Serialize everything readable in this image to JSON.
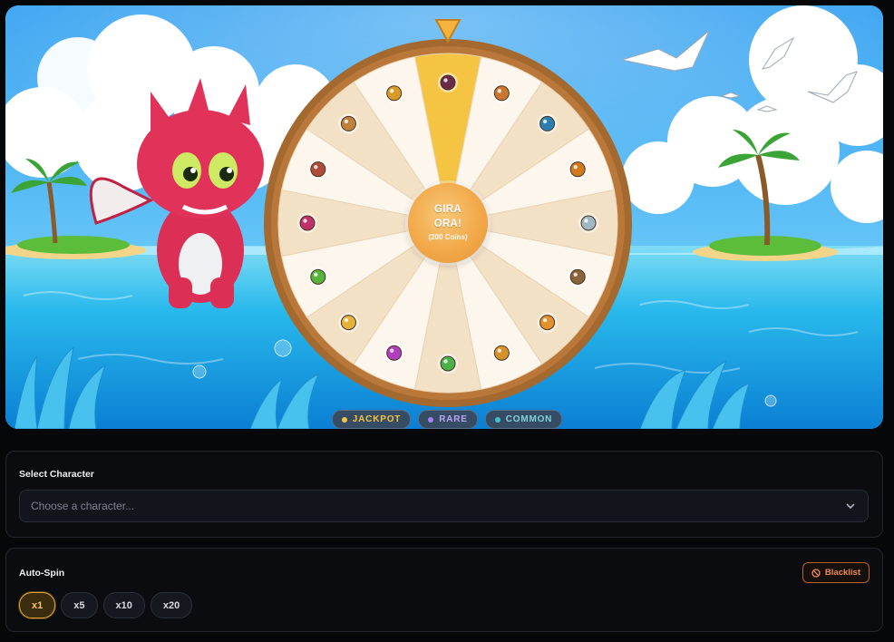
{
  "wheel": {
    "hub_line1": "GIRA",
    "hub_line2": "ORA!",
    "hub_line3": "(200 Coins)",
    "segments": [
      {
        "icon": "potion-bottle-icon",
        "rarity": "jackpot"
      },
      {
        "icon": "backpack-icon",
        "rarity": "common"
      },
      {
        "icon": "blue-crystal-icon",
        "rarity": "common"
      },
      {
        "icon": "gear-ring-icon",
        "rarity": "common"
      },
      {
        "icon": "scroll-icon",
        "rarity": "common"
      },
      {
        "icon": "pickaxe-icon",
        "rarity": "common"
      },
      {
        "icon": "orange-orb-icon",
        "rarity": "common"
      },
      {
        "icon": "gold-coin-icon",
        "rarity": "common"
      },
      {
        "icon": "green-gem-icon",
        "rarity": "common"
      },
      {
        "icon": "purple-gem-icon",
        "rarity": "common"
      },
      {
        "icon": "gold-nugget-icon",
        "rarity": "common"
      },
      {
        "icon": "green-ring-icon",
        "rarity": "common"
      },
      {
        "icon": "ruby-gem-icon",
        "rarity": "common"
      },
      {
        "icon": "armor-icon",
        "rarity": "common"
      },
      {
        "icon": "treasure-chest-icon",
        "rarity": "common"
      },
      {
        "icon": "medal-icon",
        "rarity": "common"
      }
    ]
  },
  "legend": {
    "jackpot": "JACKPOT",
    "rare": "RARE",
    "common": "COMMON"
  },
  "character_select": {
    "title": "Select Character",
    "placeholder": "Choose a character..."
  },
  "auto_spin": {
    "title": "Auto-Spin",
    "blacklist_label": "Blacklist",
    "options": [
      "x1",
      "x5",
      "x10",
      "x20"
    ],
    "selected": "x1"
  },
  "colors": {
    "jackpot": "#f4c542",
    "rare": "#a782f5",
    "common": "#3fc2cc",
    "wheel_rim": "#a4692f",
    "segment_light": "#fdf6ec",
    "segment_alt": "#f3e1c6",
    "accent": "#e3a233",
    "blacklist": "#f08a4b"
  }
}
